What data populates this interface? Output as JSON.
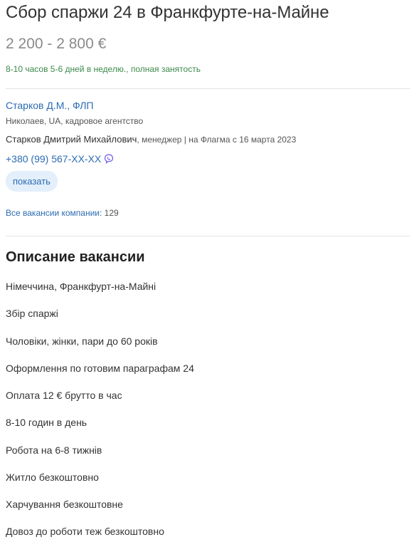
{
  "vacancy": {
    "title": "Сбор спаржи 24 в Франкфурте-на-Майне",
    "salary": "2 200 - 2 800 €",
    "schedule": "8-10 часов 5-6 дней в неделю., полная занятость"
  },
  "company": {
    "name": "Старков Д.М., ФЛП",
    "location": "Николаев, UA, кадровое агентство",
    "contact_name": "Старков Дмитрий Михайлович",
    "contact_meta": ", менеджер | на Флагма с 16 марта 2023",
    "phone": "+380 (99) 567-XX-XX",
    "show_button": "показать",
    "all_vacancies_label": "Все вакансии компании:",
    "all_vacancies_count": "129"
  },
  "description": {
    "heading": "Описание вакансии",
    "lines": [
      "Німеччина, Франкфурт-на-Майні",
      "Збір спаржі",
      "Чоловіки, жінки, пари до 60 років",
      "Оформлення по готовим параграфам 24",
      "Оплата 12 € брутто в час",
      "8-10 годин в день",
      "Робота на 6-8 тижнів",
      "Житло безкоштовно",
      "Харчування безкоштовне",
      "Довоз до роботи теж безкоштовно"
    ]
  },
  "colors": {
    "link": "#2c6cb3",
    "schedule": "#3c8a4b",
    "viber": "#7360f2"
  },
  "icons": {
    "phone_messenger": "viber-icon"
  }
}
